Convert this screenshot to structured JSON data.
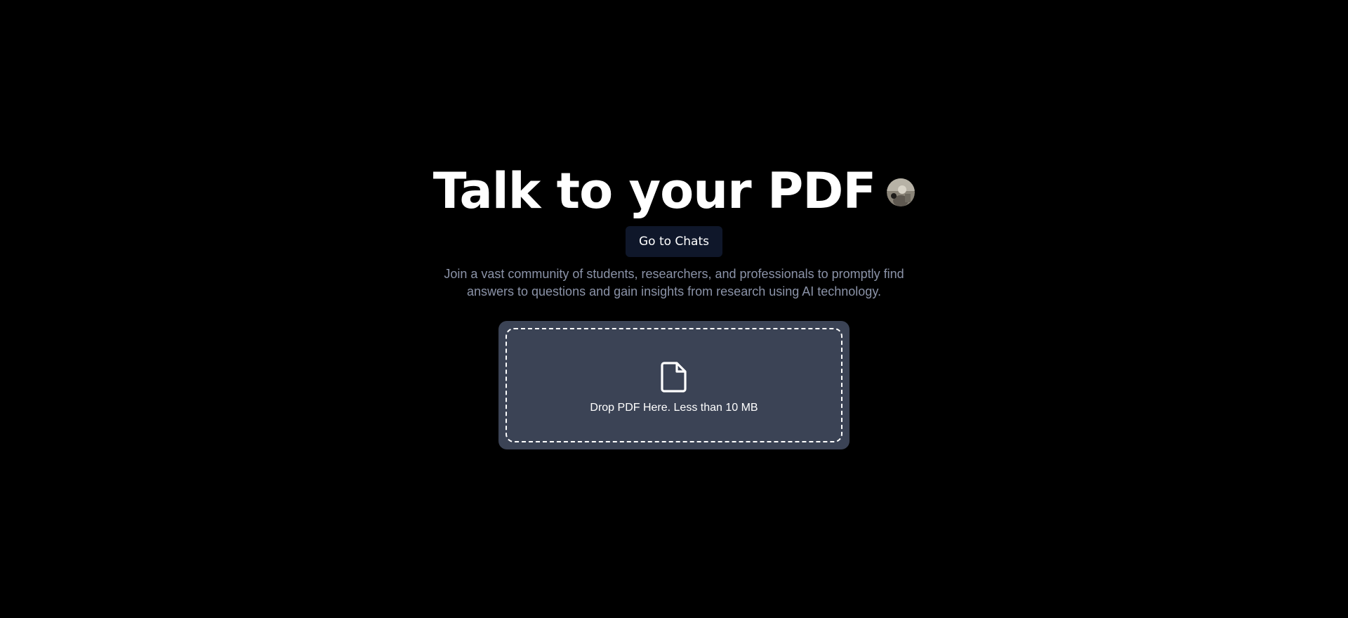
{
  "hero": {
    "title": "Talk to your PDF",
    "avatar_icon": "user-avatar-photo",
    "chats_button_label": "Go to Chats",
    "description": "Join a vast community of students, researchers, and professionals to promptly find answers to questions and gain insights from research using AI technology."
  },
  "upload": {
    "icon": "file-icon",
    "label": "Drop PDF Here. Less than 10 MB"
  },
  "colors": {
    "background": "#000000",
    "button_bg": "#0f172a",
    "dropzone_bg": "#3b4355",
    "description_text": "#8b93a8"
  }
}
